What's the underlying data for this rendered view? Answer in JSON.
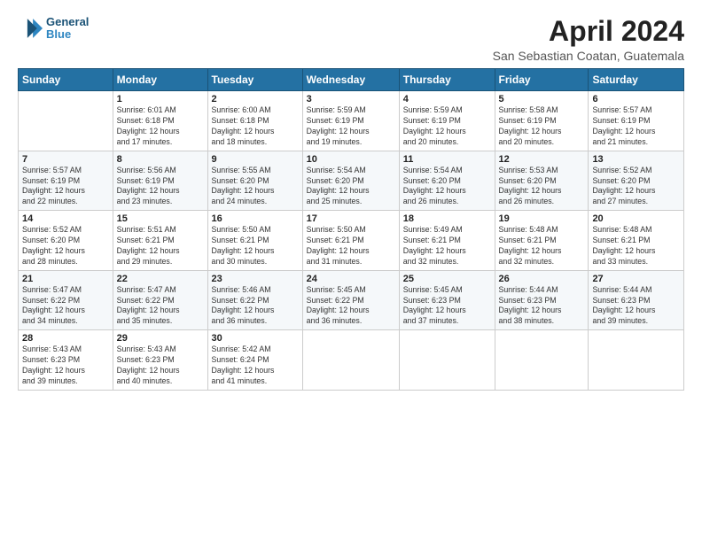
{
  "logo": {
    "line1": "General",
    "line2": "Blue"
  },
  "title": "April 2024",
  "subtitle": "San Sebastian Coatan, Guatemala",
  "weekdays": [
    "Sunday",
    "Monday",
    "Tuesday",
    "Wednesday",
    "Thursday",
    "Friday",
    "Saturday"
  ],
  "weeks": [
    [
      {
        "day": "",
        "info": ""
      },
      {
        "day": "1",
        "info": "Sunrise: 6:01 AM\nSunset: 6:18 PM\nDaylight: 12 hours\nand 17 minutes."
      },
      {
        "day": "2",
        "info": "Sunrise: 6:00 AM\nSunset: 6:18 PM\nDaylight: 12 hours\nand 18 minutes."
      },
      {
        "day": "3",
        "info": "Sunrise: 5:59 AM\nSunset: 6:19 PM\nDaylight: 12 hours\nand 19 minutes."
      },
      {
        "day": "4",
        "info": "Sunrise: 5:59 AM\nSunset: 6:19 PM\nDaylight: 12 hours\nand 20 minutes."
      },
      {
        "day": "5",
        "info": "Sunrise: 5:58 AM\nSunset: 6:19 PM\nDaylight: 12 hours\nand 20 minutes."
      },
      {
        "day": "6",
        "info": "Sunrise: 5:57 AM\nSunset: 6:19 PM\nDaylight: 12 hours\nand 21 minutes."
      }
    ],
    [
      {
        "day": "7",
        "info": "Sunrise: 5:57 AM\nSunset: 6:19 PM\nDaylight: 12 hours\nand 22 minutes."
      },
      {
        "day": "8",
        "info": "Sunrise: 5:56 AM\nSunset: 6:19 PM\nDaylight: 12 hours\nand 23 minutes."
      },
      {
        "day": "9",
        "info": "Sunrise: 5:55 AM\nSunset: 6:20 PM\nDaylight: 12 hours\nand 24 minutes."
      },
      {
        "day": "10",
        "info": "Sunrise: 5:54 AM\nSunset: 6:20 PM\nDaylight: 12 hours\nand 25 minutes."
      },
      {
        "day": "11",
        "info": "Sunrise: 5:54 AM\nSunset: 6:20 PM\nDaylight: 12 hours\nand 26 minutes."
      },
      {
        "day": "12",
        "info": "Sunrise: 5:53 AM\nSunset: 6:20 PM\nDaylight: 12 hours\nand 26 minutes."
      },
      {
        "day": "13",
        "info": "Sunrise: 5:52 AM\nSunset: 6:20 PM\nDaylight: 12 hours\nand 27 minutes."
      }
    ],
    [
      {
        "day": "14",
        "info": "Sunrise: 5:52 AM\nSunset: 6:20 PM\nDaylight: 12 hours\nand 28 minutes."
      },
      {
        "day": "15",
        "info": "Sunrise: 5:51 AM\nSunset: 6:21 PM\nDaylight: 12 hours\nand 29 minutes."
      },
      {
        "day": "16",
        "info": "Sunrise: 5:50 AM\nSunset: 6:21 PM\nDaylight: 12 hours\nand 30 minutes."
      },
      {
        "day": "17",
        "info": "Sunrise: 5:50 AM\nSunset: 6:21 PM\nDaylight: 12 hours\nand 31 minutes."
      },
      {
        "day": "18",
        "info": "Sunrise: 5:49 AM\nSunset: 6:21 PM\nDaylight: 12 hours\nand 32 minutes."
      },
      {
        "day": "19",
        "info": "Sunrise: 5:48 AM\nSunset: 6:21 PM\nDaylight: 12 hours\nand 32 minutes."
      },
      {
        "day": "20",
        "info": "Sunrise: 5:48 AM\nSunset: 6:21 PM\nDaylight: 12 hours\nand 33 minutes."
      }
    ],
    [
      {
        "day": "21",
        "info": "Sunrise: 5:47 AM\nSunset: 6:22 PM\nDaylight: 12 hours\nand 34 minutes."
      },
      {
        "day": "22",
        "info": "Sunrise: 5:47 AM\nSunset: 6:22 PM\nDaylight: 12 hours\nand 35 minutes."
      },
      {
        "day": "23",
        "info": "Sunrise: 5:46 AM\nSunset: 6:22 PM\nDaylight: 12 hours\nand 36 minutes."
      },
      {
        "day": "24",
        "info": "Sunrise: 5:45 AM\nSunset: 6:22 PM\nDaylight: 12 hours\nand 36 minutes."
      },
      {
        "day": "25",
        "info": "Sunrise: 5:45 AM\nSunset: 6:23 PM\nDaylight: 12 hours\nand 37 minutes."
      },
      {
        "day": "26",
        "info": "Sunrise: 5:44 AM\nSunset: 6:23 PM\nDaylight: 12 hours\nand 38 minutes."
      },
      {
        "day": "27",
        "info": "Sunrise: 5:44 AM\nSunset: 6:23 PM\nDaylight: 12 hours\nand 39 minutes."
      }
    ],
    [
      {
        "day": "28",
        "info": "Sunrise: 5:43 AM\nSunset: 6:23 PM\nDaylight: 12 hours\nand 39 minutes."
      },
      {
        "day": "29",
        "info": "Sunrise: 5:43 AM\nSunset: 6:23 PM\nDaylight: 12 hours\nand 40 minutes."
      },
      {
        "day": "30",
        "info": "Sunrise: 5:42 AM\nSunset: 6:24 PM\nDaylight: 12 hours\nand 41 minutes."
      },
      {
        "day": "",
        "info": ""
      },
      {
        "day": "",
        "info": ""
      },
      {
        "day": "",
        "info": ""
      },
      {
        "day": "",
        "info": ""
      }
    ]
  ]
}
